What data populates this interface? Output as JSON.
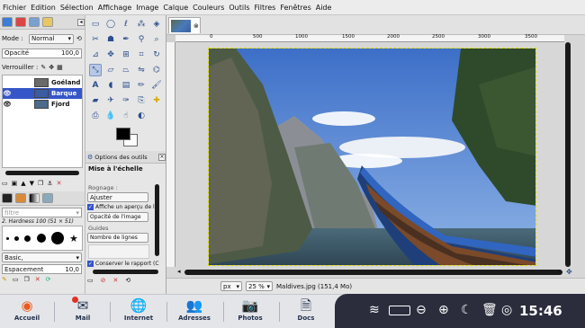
{
  "menu": [
    "Fichier",
    "Edition",
    "Sélection",
    "Affichage",
    "Image",
    "Calque",
    "Couleurs",
    "Outils",
    "Filtres",
    "Fenêtres",
    "Aide"
  ],
  "layers_panel": {
    "mode_label": "Mode :",
    "mode_value": "Normal",
    "opacity_label": "Opacité",
    "opacity_value": "100,0",
    "lock_label": "Verrouiller :",
    "layers": [
      {
        "name": "Goéland",
        "selected": false,
        "visible": false
      },
      {
        "name": "Barque",
        "selected": true,
        "visible": true
      },
      {
        "name": "Fjord",
        "selected": false,
        "visible": true
      }
    ]
  },
  "brushes_panel": {
    "filter_placeholder": "filtre",
    "brush_name": "2. Hardness 100 (51 × 51)",
    "preset": "Basic,",
    "spacing_label": "Espacement",
    "spacing_value": "10,0"
  },
  "tool_options": {
    "tab_label": "Options des outils",
    "section_title": "Mise à l'échelle",
    "cropping_label": "Rognage :",
    "cropping_value": "Ajuster",
    "preview_checkbox": "Affiche un aperçu de l'é",
    "reference_value": "Opacité de l'image",
    "guides_label": "Guides",
    "guides_value": "Nombre de lignes",
    "keep_ratio_checkbox": "Conserver le rapport (C"
  },
  "canvas": {
    "unit": "px",
    "zoom": "25 %",
    "status": "Maldives.jpg (151,4 Mo)",
    "ruler_marks": [
      "0",
      "500",
      "1000",
      "1500",
      "2000",
      "2500",
      "3000",
      "3500"
    ]
  },
  "dock": {
    "items": [
      {
        "label": "Accueil",
        "icon": "home-icon"
      },
      {
        "label": "Mail",
        "icon": "mail-icon"
      },
      {
        "label": "Internet",
        "icon": "globe-icon"
      },
      {
        "label": "Adresses",
        "icon": "contacts-icon"
      },
      {
        "label": "Photos",
        "icon": "camera-icon"
      },
      {
        "label": "Docs",
        "icon": "document-icon"
      }
    ],
    "clock": "15:46"
  },
  "colors": {
    "selected_layer": "#3556c8",
    "tray_bg": "#2b2d3d",
    "accent_orange": "#ea5a1c"
  }
}
